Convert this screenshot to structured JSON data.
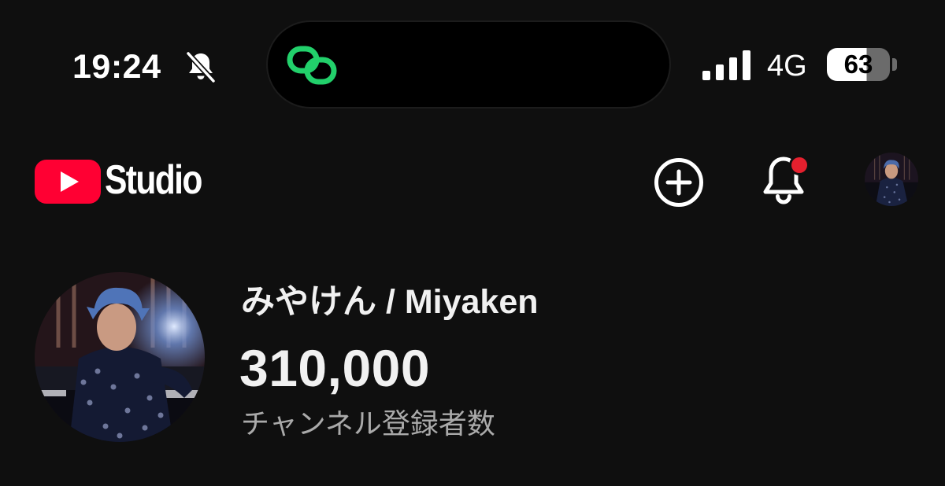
{
  "status_bar": {
    "time": "19:24",
    "silent_icon": "bell-slash-icon",
    "network": "4G",
    "battery_level": "63",
    "battery_fraction": 0.63,
    "signal_bars": 4,
    "live_activity_icon": "link-loop-icon",
    "live_activity_color": "#22d06b"
  },
  "header": {
    "brand": "Studio",
    "brand_color": "#ff0033",
    "create_icon": "plus-circle-icon",
    "notifications_icon": "bell-icon",
    "notification_badge_color": "#e5202e",
    "account_icon": "avatar"
  },
  "channel": {
    "name": "みやけん / Miyaken",
    "subscribers": "310,000",
    "subscribers_label": "チャンネル登録者数"
  }
}
